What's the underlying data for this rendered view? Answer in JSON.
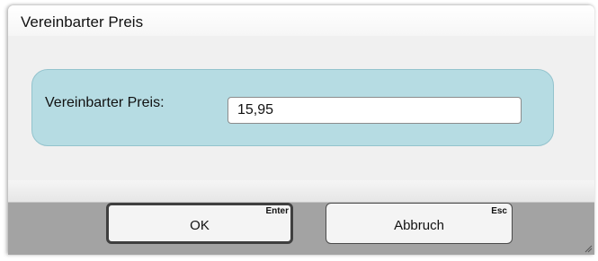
{
  "window": {
    "title": "Vereinbarter Preis"
  },
  "form": {
    "label": "Vereinbarter Preis:",
    "value": "15,95"
  },
  "buttons": {
    "ok": {
      "label": "OK",
      "shortcut": "Enter"
    },
    "cancel": {
      "label": "Abbruch",
      "shortcut": "Esc"
    }
  },
  "icons": {
    "resize": "resize-grip-icon"
  },
  "colors": {
    "panel": "#b6dce3",
    "footer": "#a3a3a3",
    "button": "#f4f4f4"
  }
}
